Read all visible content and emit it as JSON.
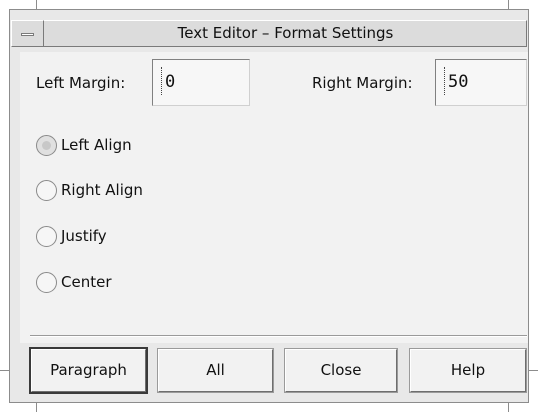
{
  "window": {
    "title": "Text Editor – Format Settings"
  },
  "margins": {
    "left_label": "Left Margin:",
    "left_value": "0",
    "right_label": "Right Margin:",
    "right_value": "50"
  },
  "alignment": {
    "options": [
      {
        "label": "Left Align",
        "selected": true
      },
      {
        "label": "Right Align",
        "selected": false
      },
      {
        "label": "Justify",
        "selected": false
      },
      {
        "label": "Center",
        "selected": false
      }
    ]
  },
  "buttons": {
    "paragraph": "Paragraph",
    "all": "All",
    "close": "Close",
    "help": "Help"
  }
}
